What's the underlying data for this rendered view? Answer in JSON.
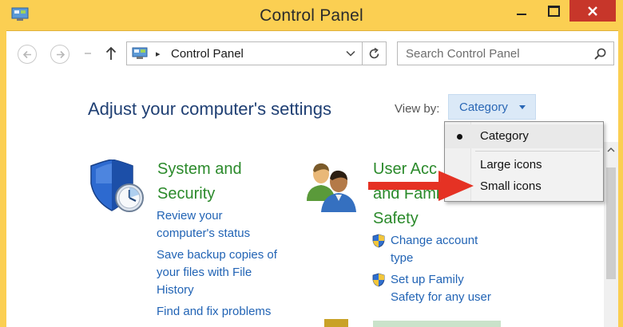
{
  "window": {
    "title": "Control Panel",
    "accent_color": "#fbcf52",
    "close_color": "#c7362a"
  },
  "navigation": {
    "address": {
      "separator": "▸",
      "location": "Control Panel"
    },
    "search": {
      "placeholder": "Search Control Panel"
    }
  },
  "content": {
    "page_title": "Adjust your computer's settings",
    "view_by": {
      "label": "View by:",
      "selected": "Category",
      "menu": {
        "items": [
          {
            "label": "Category",
            "selected": true
          },
          {
            "label": "Large icons",
            "selected": false
          },
          {
            "label": "Small icons",
            "selected": false
          }
        ]
      }
    },
    "categories": [
      {
        "title_line1": "System and",
        "title_line2": "Security",
        "icon": "shield-clock-icon",
        "links": [
          {
            "line1": "Review your",
            "line2": "computer's status"
          },
          {
            "line1": "Save backup copies of",
            "line2": "your files with File",
            "line3": "History"
          },
          {
            "line1": "Find and fix problems"
          }
        ]
      },
      {
        "title_line1": "User Acc",
        "title_line2": "and Fami",
        "title_line3": "Safety",
        "icon": "users-icon",
        "links": [
          {
            "line1": "Change account",
            "line2": "type",
            "icon": "uac-shield-icon"
          },
          {
            "line1": "Set up Family",
            "line2": "Safety for any user",
            "icon": "uac-shield-icon"
          }
        ]
      }
    ]
  },
  "annotation": {
    "icon": "red-arrow-icon",
    "color": "#e53224"
  }
}
